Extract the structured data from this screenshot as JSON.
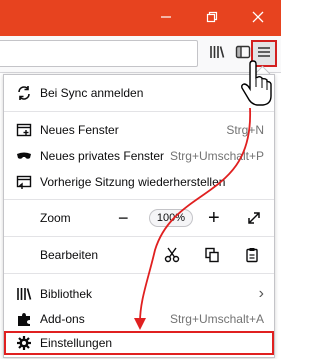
{
  "colors": {
    "titlebar": "#e7431f",
    "highlight": "#e02020",
    "shortcut": "#737373"
  },
  "window_controls": {
    "minimize_icon": "minimize-icon",
    "restore_icon": "restore-icon",
    "close_icon": "close-icon"
  },
  "toolbar": {
    "library_icon": "library-icon",
    "sidebar_icon": "sidebar-icon",
    "menu_icon": "hamburger-menu-icon"
  },
  "menu": {
    "sync": {
      "label": "Bei Sync anmelden",
      "icon": "sync-icon"
    },
    "new_window": {
      "label": "Neues Fenster",
      "shortcut": "Strg+N",
      "icon": "new-window-icon"
    },
    "private_window": {
      "label": "Neues privates Fenster",
      "shortcut": "Strg+Umschalt+P",
      "icon": "private-mask-icon"
    },
    "restore_session": {
      "label": "Vorherige Sitzung wiederherstellen",
      "icon": "restore-session-icon"
    },
    "zoom": {
      "label": "Zoom",
      "value": "100%",
      "minus": "−",
      "plus": "+",
      "fullscreen_icon": "fullscreen-icon"
    },
    "edit": {
      "label": "Bearbeiten",
      "cut_icon": "scissors-icon",
      "copy_icon": "copy-icon",
      "paste_icon": "paste-icon"
    },
    "library": {
      "label": "Bibliothek",
      "icon": "library-icon",
      "chevron": "›"
    },
    "addons": {
      "label": "Add-ons",
      "shortcut": "Strg+Umschalt+A",
      "icon": "puzzle-icon"
    },
    "settings": {
      "label": "Einstellungen",
      "icon": "gear-icon"
    }
  }
}
